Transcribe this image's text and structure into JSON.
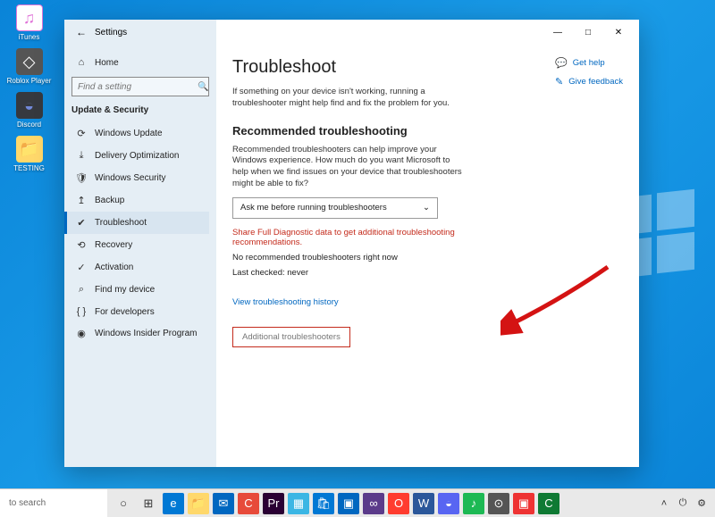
{
  "desktop": {
    "itunes": "iTunes",
    "roblox": "Roblox Player",
    "discord": "Discord",
    "testing": "TESTING"
  },
  "window": {
    "title": "Settings",
    "titlebar": {
      "back": "←",
      "min": "—",
      "max": "□",
      "close": "✕"
    }
  },
  "sidebar": {
    "home": "Home",
    "search_placeholder": "Find a setting",
    "search_icon": "🔍",
    "section": "Update & Security",
    "items": [
      {
        "icon": "⟳",
        "label": "Windows Update"
      },
      {
        "icon": "⤓",
        "label": "Delivery Optimization"
      },
      {
        "icon": "🛡",
        "label": "Windows Security"
      },
      {
        "icon": "↥",
        "label": "Backup"
      },
      {
        "icon": "✔",
        "label": "Troubleshoot"
      },
      {
        "icon": "⟲",
        "label": "Recovery"
      },
      {
        "icon": "✓",
        "label": "Activation"
      },
      {
        "icon": "⌕",
        "label": "Find my device"
      },
      {
        "icon": "{ }",
        "label": "For developers"
      },
      {
        "icon": "◉",
        "label": "Windows Insider Program"
      }
    ]
  },
  "content": {
    "h1": "Troubleshoot",
    "intro": "If something on your device isn't working, running a troubleshooter might help find and fix the problem for you.",
    "h2": "Recommended troubleshooting",
    "rec_text": "Recommended troubleshooters can help improve your Windows experience. How much do you want Microsoft to help when we find issues on your device that troubleshooters might be able to fix?",
    "select_value": "Ask me before running troubleshooters",
    "select_chevron": "⌄",
    "warning": "Share Full Diagnostic data to get additional troubleshooting recommendations.",
    "no_rec": "No recommended troubleshooters right now",
    "last_checked": "Last checked: never",
    "history_link": "View troubleshooting history",
    "additional": "Additional troubleshooters"
  },
  "rlinks": {
    "help": "Get help",
    "feedback": "Give feedback"
  },
  "taskbar": {
    "search": "to search"
  }
}
